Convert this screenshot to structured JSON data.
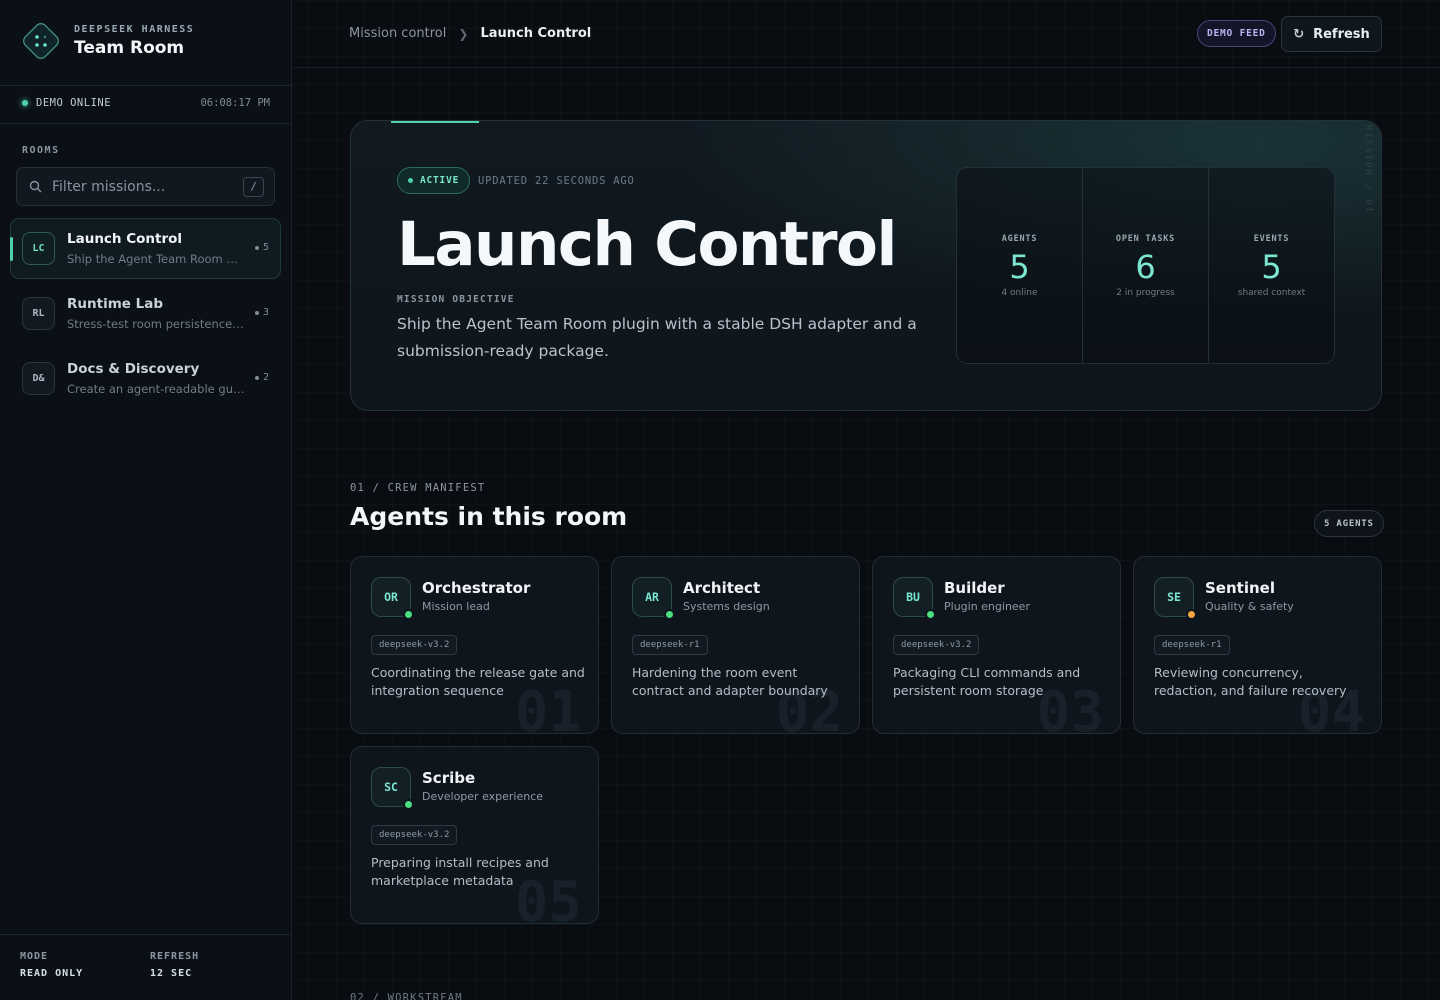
{
  "brand": {
    "kicker": "DEEPSEEK HARNESS",
    "title": "Team Room"
  },
  "status": {
    "label": "DEMO ONLINE",
    "time": "06:08:17 PM",
    "color": "#4fd1b0"
  },
  "sidebar": {
    "rooms_label": "ROOMS",
    "search_placeholder": "Filter missions...",
    "search_shortcut": "/",
    "rooms": [
      {
        "badge": "LC",
        "title": "Launch Control",
        "desc": "Ship the Agent Team Room pl...",
        "count": "5",
        "active": true
      },
      {
        "badge": "RL",
        "title": "Runtime Lab",
        "desc": "Stress-test room persistence ...",
        "count": "3",
        "active": false
      },
      {
        "badge": "D&",
        "title": "Docs & Discovery",
        "desc": "Create an agent-readable gui...",
        "count": "2",
        "active": false
      }
    ],
    "footer": {
      "mode_label": "MODE",
      "mode_value": "READ ONLY",
      "refresh_label": "REFRESH",
      "refresh_value": "12 SEC"
    }
  },
  "topbar": {
    "breadcrumb": [
      "Mission control",
      "Launch Control"
    ],
    "demo_feed": "DEMO FEED",
    "refresh_label": "Refresh"
  },
  "hero": {
    "status_pill": "ACTIVE",
    "updated": "UPDATED 22 SECONDS AGO",
    "title": "Launch Control",
    "objective_label": "MISSION OBJECTIVE",
    "objective": "Ship the Agent Team Room plugin with a stable DSH adapter and a submission-ready package.",
    "vertical_tag": "MISSION / 01",
    "stats": [
      {
        "label": "AGENTS",
        "value": "5",
        "sub": "4 online"
      },
      {
        "label": "OPEN TASKS",
        "value": "6",
        "sub": "2 in progress"
      },
      {
        "label": "EVENTS",
        "value": "5",
        "sub": "shared context"
      }
    ]
  },
  "crew": {
    "kicker": "01 / CREW MANIFEST",
    "title": "Agents in this room",
    "count_pill": "5 AGENTS",
    "agents": [
      {
        "initials": "OR",
        "name": "Orchestrator",
        "role": "Mission lead",
        "model": "deepseek-v3.2",
        "desc": "Coordinating the release gate and integration sequence",
        "num": "01",
        "status_color": "#4ade80"
      },
      {
        "initials": "AR",
        "name": "Architect",
        "role": "Systems design",
        "model": "deepseek-r1",
        "desc": "Hardening the room event contract and adapter boundary",
        "num": "02",
        "status_color": "#4ade80"
      },
      {
        "initials": "BU",
        "name": "Builder",
        "role": "Plugin engineer",
        "model": "deepseek-v3.2",
        "desc": "Packaging CLI commands and persistent room storage",
        "num": "03",
        "status_color": "#4ade80"
      },
      {
        "initials": "SE",
        "name": "Sentinel",
        "role": "Quality & safety",
        "model": "deepseek-r1",
        "desc": "Reviewing concurrency, redaction, and failure recovery",
        "num": "04",
        "status_color": "#f5a742"
      },
      {
        "initials": "SC",
        "name": "Scribe",
        "role": "Developer experience",
        "model": "deepseek-v3.2",
        "desc": "Preparing install recipes and marketplace metadata",
        "num": "05",
        "status_color": "#4ade80"
      }
    ]
  },
  "next_section_kicker": "02 / WORKSTREAM"
}
